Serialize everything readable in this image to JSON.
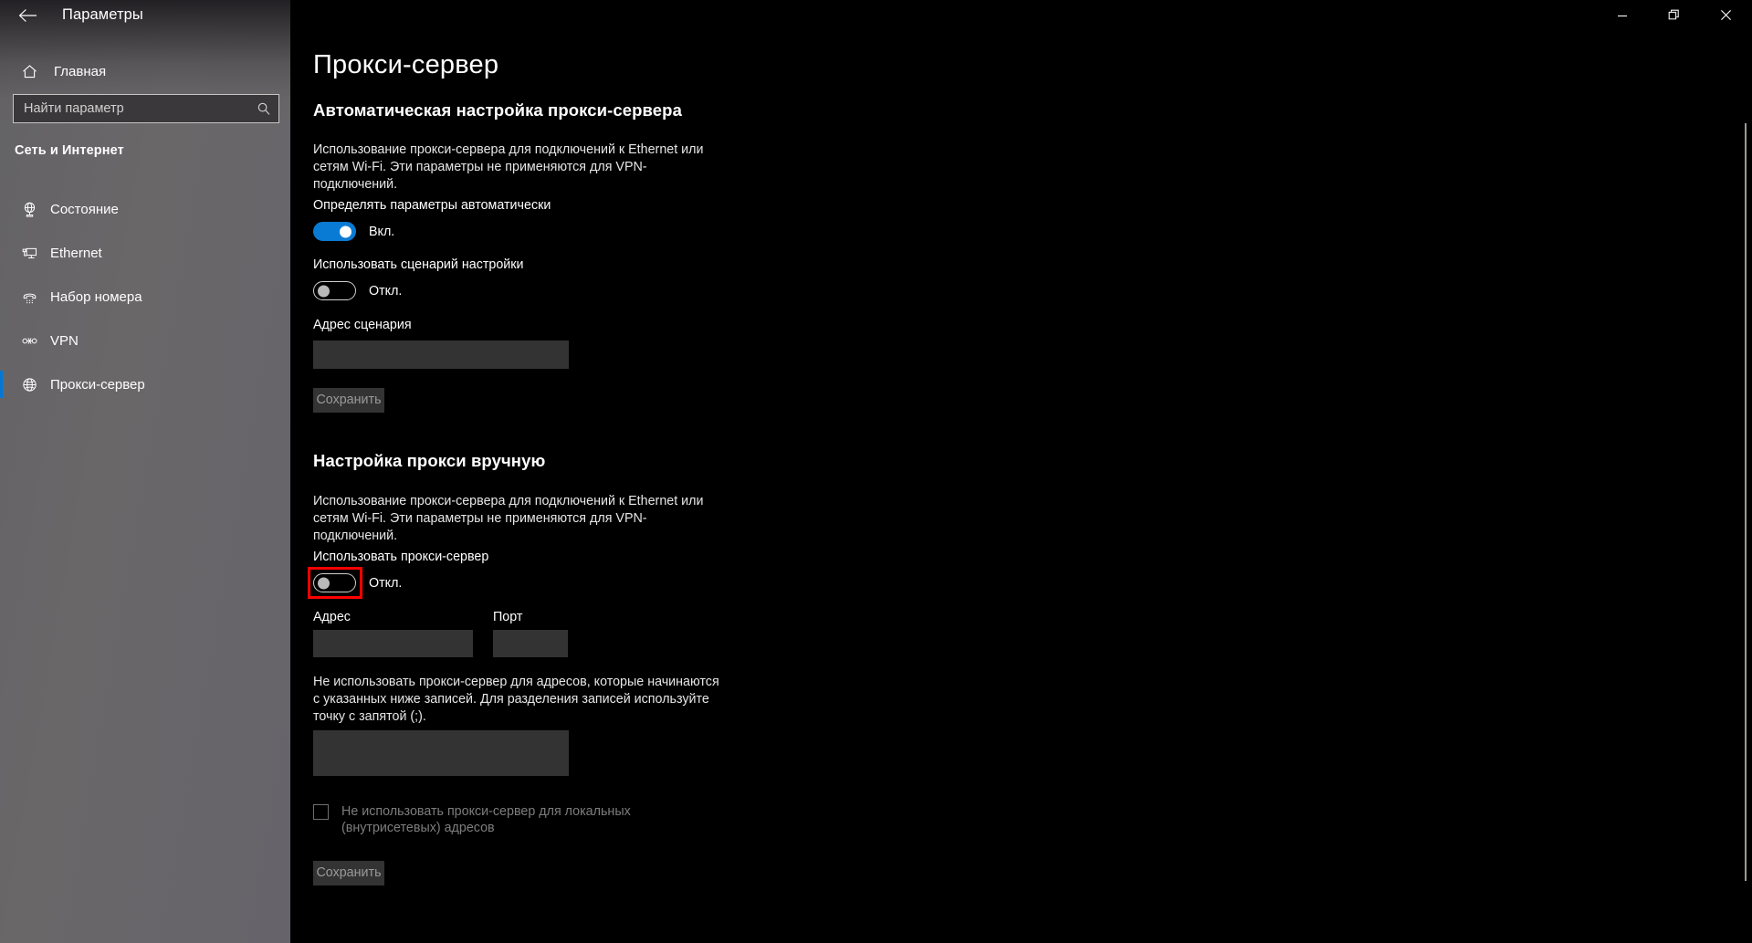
{
  "window": {
    "title": "Параметры",
    "back_icon": "back-arrow-icon",
    "minimize_label": "Свернуть",
    "restore_label": "Развернуть",
    "close_label": "Закрыть"
  },
  "sidebar": {
    "home": {
      "label": "Главная",
      "icon": "home-icon"
    },
    "search": {
      "placeholder": "Найти параметр",
      "value": "",
      "icon": "search-icon"
    },
    "category": "Сеть и Интернет",
    "items": [
      {
        "label": "Состояние",
        "icon": "network-status-icon",
        "selected": false
      },
      {
        "label": "Ethernet",
        "icon": "ethernet-icon",
        "selected": false
      },
      {
        "label": "Набор номера",
        "icon": "dial-up-phone-icon",
        "selected": false
      },
      {
        "label": "VPN",
        "icon": "vpn-icon",
        "selected": false
      },
      {
        "label": "Прокси-сервер",
        "icon": "globe-icon",
        "selected": true
      }
    ],
    "accent_color": "#0078d7"
  },
  "main": {
    "page_title": "Прокси-сервер",
    "auto_section": {
      "heading": "Автоматическая настройка прокси-сервера",
      "description": "Использование прокси-сервера для подключений к Ethernet или сетям Wi-Fi. Эти параметры не применяются для VPN-подключений.",
      "auto_detect": {
        "label": "Определять параметры автоматически",
        "state": "Вкл.",
        "on": true
      },
      "use_script": {
        "label": "Использовать сценарий настройки",
        "state": "Откл.",
        "on": false
      },
      "script_address": {
        "label": "Адрес сценария",
        "value": "",
        "placeholder": ""
      },
      "save_label": "Сохранить"
    },
    "manual_section": {
      "heading": "Настройка прокси вручную",
      "description": "Использование прокси-сервера для подключений к Ethernet или сетям Wi-Fi. Эти параметры не применяются для VPN-подключений.",
      "use_proxy": {
        "label": "Использовать прокси-сервер",
        "state": "Откл.",
        "on": false,
        "highlighted": true,
        "highlight_color": "#ff0000"
      },
      "address": {
        "label": "Адрес",
        "value": "",
        "placeholder": ""
      },
      "port": {
        "label": "Порт",
        "value": "",
        "placeholder": ""
      },
      "exceptions_description": "Не использовать прокси-сервер для адресов, которые начинаются с указанных ниже записей. Для разделения записей используйте точку с запятой (;).",
      "exceptions": {
        "value": "",
        "placeholder": ""
      },
      "bypass_local": {
        "label": "Не использовать прокси-сервер для локальных (внутрисетевых) адресов",
        "checked": false
      },
      "save_label": "Сохранить"
    }
  }
}
